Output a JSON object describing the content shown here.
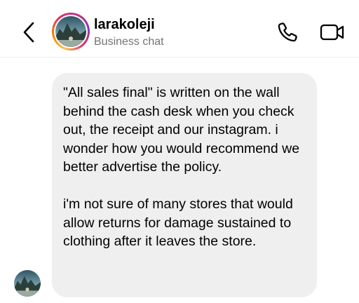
{
  "header": {
    "username": "larakoleji",
    "subtitle": "Business chat"
  },
  "icons": {
    "back": "chevron-left-icon",
    "call": "phone-icon",
    "video": "video-camera-icon"
  },
  "messages": [
    {
      "sender": "larakoleji",
      "paragraphs": [
        "\"All sales final\" is written on the wall behind the cash desk when you check out, the receipt and our instagram. i wonder how you would recommend we better advertise the policy.",
        "i'm not sure of many stores that would allow returns for damage sustained to clothing after it leaves the store."
      ]
    }
  ],
  "colors": {
    "bubble_background": "#efefef",
    "subtitle_text": "#737373",
    "avatar_ring": [
      "#f9c74f",
      "#f77f00",
      "#e1306c",
      "#c13584",
      "#833ab4"
    ]
  }
}
